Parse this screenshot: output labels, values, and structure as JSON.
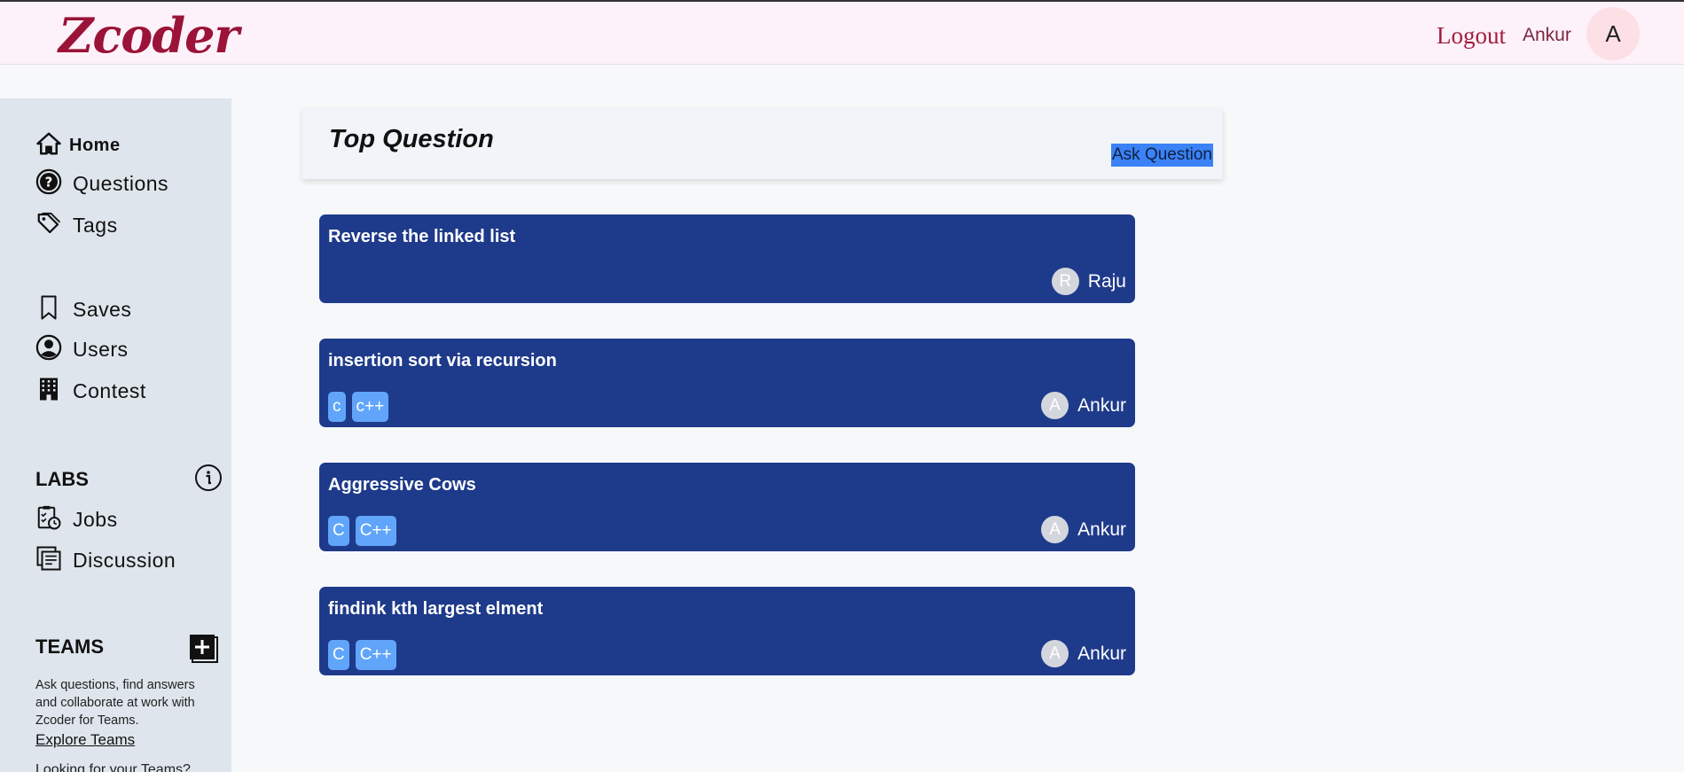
{
  "topbar": {
    "logo": "Zcoder",
    "logout_label": "Logout",
    "username": "Ankur",
    "avatar_initial": "A"
  },
  "sidebar": {
    "nav": [
      {
        "label": "Home",
        "icon": "home-icon"
      },
      {
        "label": "Questions",
        "icon": "question-circle-icon"
      },
      {
        "label": "Tags",
        "icon": "tags-icon"
      },
      {
        "label": "Saves",
        "icon": "bookmark-icon"
      },
      {
        "label": "Users",
        "icon": "user-circle-icon"
      },
      {
        "label": "Contest",
        "icon": "building-icon"
      }
    ],
    "labs": {
      "title": "LABS",
      "items": [
        {
          "label": "Jobs",
          "icon": "clipboard-clock-icon"
        },
        {
          "label": "Discussion",
          "icon": "discussion-icon"
        }
      ]
    },
    "teams": {
      "title": "TEAMS",
      "description": "Ask questions, find answers and collaborate at work with Zcoder for Teams.",
      "explore_link": "Explore Teams",
      "looking_text": "Looking for your Teams?"
    }
  },
  "main": {
    "header_title": "Top Question",
    "ask_button": "Ask Question",
    "questions": [
      {
        "title": "Reverse the linked list",
        "tags": [],
        "author_initial": "R",
        "author": "Raju"
      },
      {
        "title": "insertion sort via recursion",
        "tags": [
          "c",
          "c++"
        ],
        "author_initial": "A",
        "author": "Ankur"
      },
      {
        "title": "Aggressive Cows",
        "tags": [
          "C",
          "C++"
        ],
        "author_initial": "A",
        "author": "Ankur"
      },
      {
        "title": "findink kth largest elment",
        "tags": [
          "C",
          "C++"
        ],
        "author_initial": "A",
        "author": "Ankur"
      }
    ]
  },
  "colors": {
    "card_bg": "#1e3a8a",
    "tag_bg": "#60a5fa",
    "logo": "#9b1338",
    "topbar_bg": "#fdf1fa",
    "sidebar_bg": "#dfe5ec",
    "ask_button_bg": "#3b82f6"
  }
}
